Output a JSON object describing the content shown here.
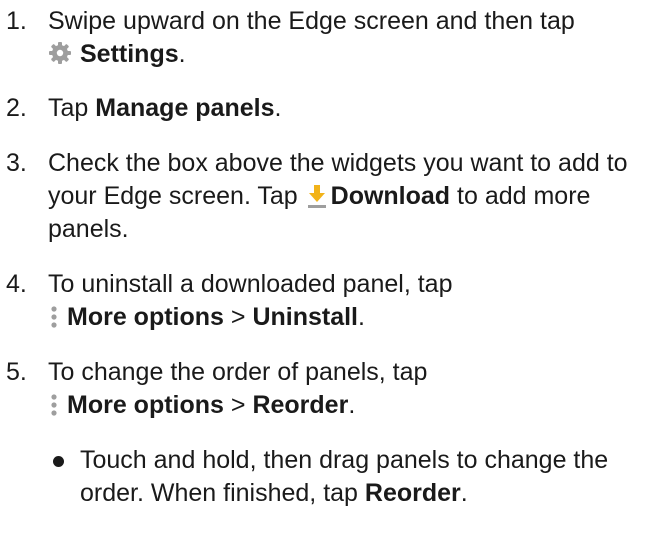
{
  "steps": [
    {
      "num": "1.",
      "t1": "Swipe upward on the Edge screen and then tap",
      "b1": "Settings",
      "t2": "."
    },
    {
      "num": "2.",
      "t1": "Tap ",
      "b1": "Manage panels",
      "t2": "."
    },
    {
      "num": "3.",
      "t1": "Check the box above the widgets you want to add to your Edge screen. Tap ",
      "b1": "Download",
      "t2": " to add more panels."
    },
    {
      "num": "4.",
      "t1": "To uninstall a downloaded panel, tap",
      "b1": "More options",
      "t2": " > ",
      "b2": "Uninstall",
      "t3": "."
    },
    {
      "num": "5.",
      "t1": "To change the order of panels, tap",
      "b1": "More options",
      "t2": " > ",
      "b2": "Reorder",
      "t3": "."
    }
  ],
  "substep": {
    "t1": "Touch and hold, then drag panels to change the order. When finished, tap ",
    "b1": "Reorder",
    "t2": "."
  },
  "icons": {
    "settings": "gear-icon",
    "download": "download-icon",
    "more_options": "more-options-icon"
  },
  "colors": {
    "text": "#1a1a1a",
    "icon_gray": "#9e9e9e",
    "download_yellow": "#f2b319"
  }
}
